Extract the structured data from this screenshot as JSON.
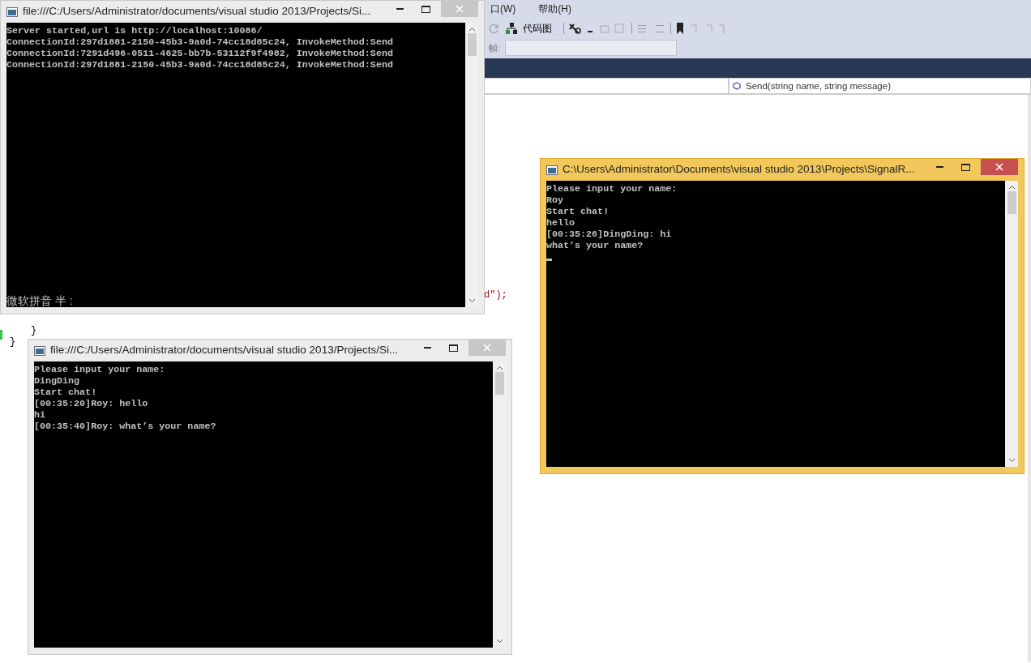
{
  "ide": {
    "menu": [
      {
        "label": "口(W)"
      },
      {
        "label": "帮助(H)"
      }
    ],
    "toolbar": {
      "code_map": "代码图",
      "stack_frame_label": "帧:"
    },
    "member_dropdown": "Send(string name, string message)",
    "code_lines": [
      "d\");",
      "}",
      "}"
    ]
  },
  "windows": [
    {
      "title": "file:///C:/Users/Administrator/documents/visual studio 2013/Projects/Si...",
      "active": false,
      "cursor": false,
      "lines": [
        "Server started,url is http://localhost:10086/",
        "ConnectionId:297d1881-2150-45b3-9a0d-74cc18d85c24, InvokeMethod:Send",
        "ConnectionId:7291d496-0511-4625-bb7b-53112f9f4982, InvokeMethod:Send",
        "ConnectionId:297d1881-2150-45b3-9a0d-74cc18d85c24, InvokeMethod:Send"
      ],
      "ime_status": "微软拼音 半 :"
    },
    {
      "title": "file:///C:/Users/Administrator/documents/visual studio 2013/Projects/Si...",
      "active": false,
      "cursor": false,
      "lines": [
        "Please input your name:",
        "DingDing",
        "Start chat!",
        "[00:35:20]Roy: hello",
        "hi",
        "[00:35:40]Roy: what’s your name?"
      ]
    },
    {
      "title": "C:\\Users\\Administrator\\Documents\\visual studio 2013\\Projects\\SignalR...",
      "active": true,
      "cursor": true,
      "lines": [
        "Please input your name:",
        "Roy",
        "Start chat!",
        "hello",
        "[00:35:26]DingDing: hi",
        "what’s your name?"
      ]
    }
  ]
}
